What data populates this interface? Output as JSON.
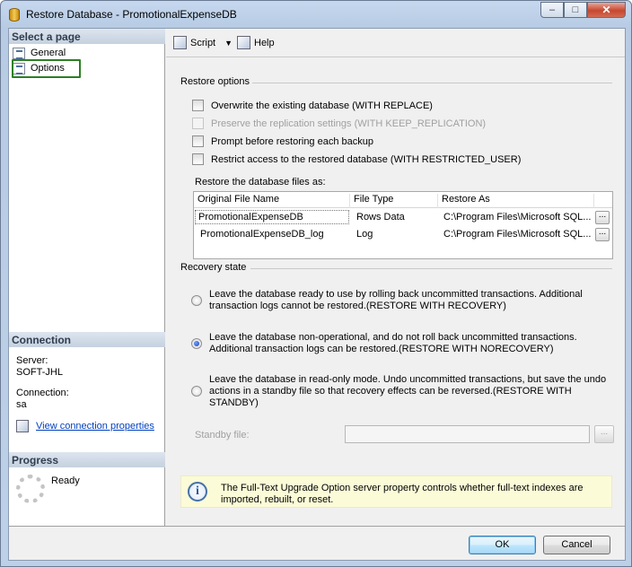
{
  "window": {
    "title": "Restore Database - PromotionalExpenseDB",
    "min": "–",
    "max": "□",
    "close": "✕"
  },
  "sidebar": {
    "select_page_header": "Select a page",
    "pages": [
      {
        "label": "General"
      },
      {
        "label": "Options"
      }
    ],
    "connection_header": "Connection",
    "server_label": "Server:",
    "server_value": "SOFT-JHL",
    "connection_label": "Connection:",
    "connection_value": "sa",
    "view_connection_link": "View connection properties",
    "progress_header": "Progress",
    "progress_status": "Ready"
  },
  "toolbar": {
    "script_label": "Script",
    "help_label": "Help"
  },
  "restore_options": {
    "header": "Restore options",
    "checkboxes": [
      {
        "label": "Overwrite the existing database (WITH REPLACE)",
        "checked": false,
        "enabled": true
      },
      {
        "label": "Preserve the replication settings (WITH KEEP_REPLICATION)",
        "checked": false,
        "enabled": false
      },
      {
        "label": "Prompt before restoring each backup",
        "checked": false,
        "enabled": true
      },
      {
        "label": "Restrict access to the restored database (WITH RESTRICTED_USER)",
        "checked": false,
        "enabled": true
      }
    ],
    "files_label": "Restore the database files as:",
    "columns": [
      "Original File Name",
      "File Type",
      "Restore As"
    ],
    "rows": [
      {
        "name": "PromotionalExpenseDB",
        "type": "Rows Data",
        "restore_as": "C:\\Program Files\\Microsoft SQL...",
        "browse": "..."
      },
      {
        "name": "PromotionalExpenseDB_log",
        "type": "Log",
        "restore_as": "C:\\Program Files\\Microsoft SQL...",
        "browse": "..."
      }
    ]
  },
  "recovery": {
    "header": "Recovery state",
    "options": [
      {
        "text": "Leave the database ready to use by rolling back uncommitted transactions. Additional transaction logs cannot be restored.(RESTORE WITH RECOVERY)",
        "selected": false
      },
      {
        "text": "Leave the database non-operational, and do not roll back uncommitted transactions. Additional transaction logs can be restored.(RESTORE WITH NORECOVERY)",
        "selected": true
      },
      {
        "text": "Leave the database in read-only mode. Undo uncommitted transactions, but save the undo actions in a standby file so that recovery effects can be reversed.(RESTORE WITH STANDBY)",
        "selected": false
      }
    ],
    "standby_label": "Standby file:",
    "standby_value": "",
    "standby_browse": "..."
  },
  "info": {
    "icon": "i",
    "text": "The Full-Text Upgrade Option server property controls whether full-text indexes are imported, rebuilt, or reset."
  },
  "footer": {
    "ok_label": "OK",
    "cancel_label": "Cancel"
  }
}
